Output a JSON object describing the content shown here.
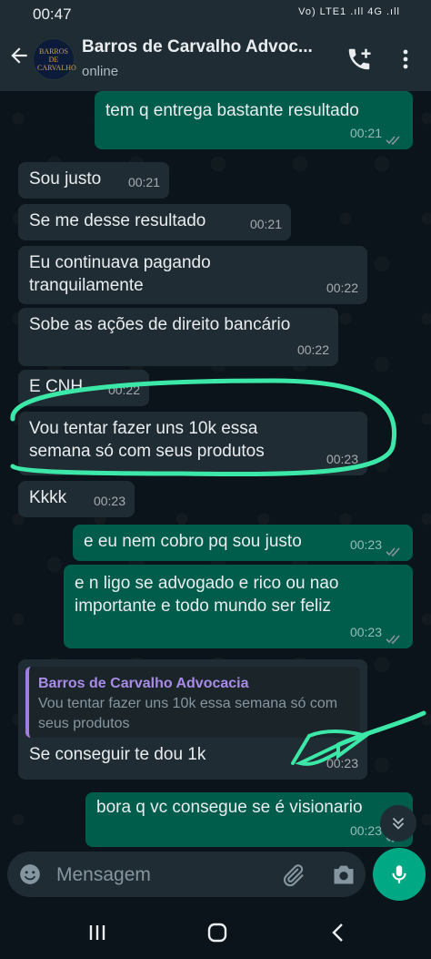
{
  "status_bar": {
    "time": "00:47",
    "indicators": "Vo) LTE1 .ıll 4G .ıll"
  },
  "header": {
    "title": "Barros de Carvalho Advoc...",
    "subtitle": "online",
    "avatar_text": "BARROS DE CARVALHO"
  },
  "messages": [
    {
      "dir": "out",
      "text": "tem q entrega bastante resultado",
      "time": "00:21",
      "read": true
    },
    {
      "dir": "in",
      "text": "Sou justo",
      "time": "00:21"
    },
    {
      "dir": "in",
      "text": "Se me desse resultado",
      "time": "00:21"
    },
    {
      "dir": "in",
      "text": "Eu continuava pagando tranquilamente",
      "time": "00:22"
    },
    {
      "dir": "in",
      "text": "Sobe as ações de direito bancário",
      "time": "00:22"
    },
    {
      "dir": "in",
      "text": "E CNH",
      "time": "00:22"
    },
    {
      "dir": "in",
      "text": "Vou tentar fazer uns 10k essa semana só com seus produtos",
      "time": "00:23"
    },
    {
      "dir": "in",
      "text": "Kkkk",
      "time": "00:23"
    },
    {
      "dir": "out",
      "text": "e eu nem cobro pq sou justo",
      "time": "00:23",
      "read": true
    },
    {
      "dir": "out",
      "text": "e n ligo se advogado e rico ou nao importante e todo mundo ser feliz",
      "time": "00:23",
      "read": true
    },
    {
      "dir": "in",
      "text": "Se conseguir te dou 1k",
      "time": "00:23",
      "quote": {
        "author": "Barros de Carvalho Advocacia",
        "text": "Vou tentar fazer uns 10k essa semana só com seus produtos"
      }
    },
    {
      "dir": "out",
      "text": "bora q vc consegue se é visionario",
      "time": "00:23",
      "read": true
    }
  ],
  "composer": {
    "placeholder": "Mensagem"
  },
  "colors": {
    "accent": "#00a884",
    "incoming": "#202c33",
    "outgoing": "#005c4b",
    "annotation": "#3ce8a8"
  },
  "icons": [
    "back-arrow-icon",
    "add-call-icon",
    "more-vert-icon",
    "emoji-icon",
    "attach-icon",
    "camera-icon",
    "mic-icon",
    "chevrons-down-icon",
    "recents-icon",
    "home-icon",
    "back-nav-icon"
  ]
}
